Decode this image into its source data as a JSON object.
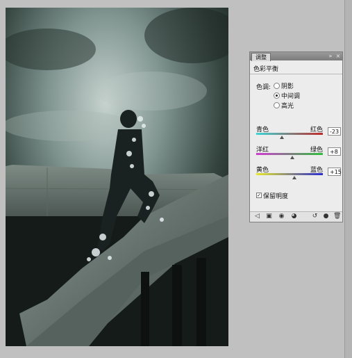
{
  "panel": {
    "tab": "调整",
    "title": "色彩平衡",
    "tone_label": "色调:",
    "tones": [
      {
        "label": "阴影",
        "selected": false
      },
      {
        "label": "中间调",
        "selected": true
      },
      {
        "label": "高光",
        "selected": false
      }
    ],
    "sliders": [
      {
        "left": "青色",
        "right": "红色",
        "value": -23,
        "display": "-23",
        "colors": [
          "#3ad6d6",
          "#c22a2a"
        ]
      },
      {
        "left": "洋红",
        "right": "绿色",
        "value": 8,
        "display": "+8",
        "colors": [
          "#d23cd2",
          "#2fbf3a"
        ]
      },
      {
        "left": "黄色",
        "right": "蓝色",
        "value": 15,
        "display": "+15",
        "colors": [
          "#e8e82a",
          "#2a2ad2"
        ]
      }
    ],
    "slider_range": [
      -100,
      100
    ],
    "preserve_luminosity": {
      "label": "保留明度",
      "checked": true
    },
    "titlebar_icons": [
      "collapse-icon",
      "close-icon",
      "menu-icon"
    ],
    "bottom_icons": [
      "back-icon",
      "clip-layer-icon",
      "visibility-icon",
      "view-previous-icon",
      "reset-icon",
      "delete-icon"
    ]
  },
  "canvas": {
    "subject": "photo-canvas"
  }
}
